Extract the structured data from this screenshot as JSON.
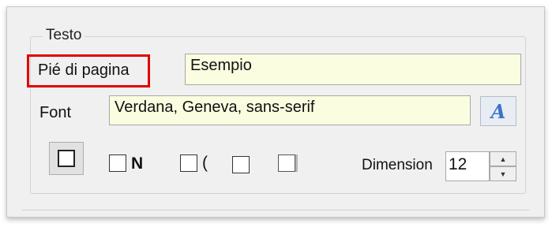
{
  "group": {
    "title": "Testo"
  },
  "footer": {
    "label": "Pié di pagina",
    "value": "Esempio"
  },
  "font": {
    "label": "Font",
    "value": "Verdana, Geneva, sans-serif",
    "button_glyph": "A",
    "button_icon": "font-picker-icon"
  },
  "style": {
    "border_icon": "border-square-icon",
    "bold_label": "N",
    "italic_label": "(",
    "size_label": "Dimension",
    "size_value": "12",
    "up_glyph": "▲",
    "down_glyph": "▼"
  },
  "colors": {
    "highlight": "#e00000",
    "field_bg": "#fbfde0",
    "icon_blue": "#3b73c8"
  }
}
